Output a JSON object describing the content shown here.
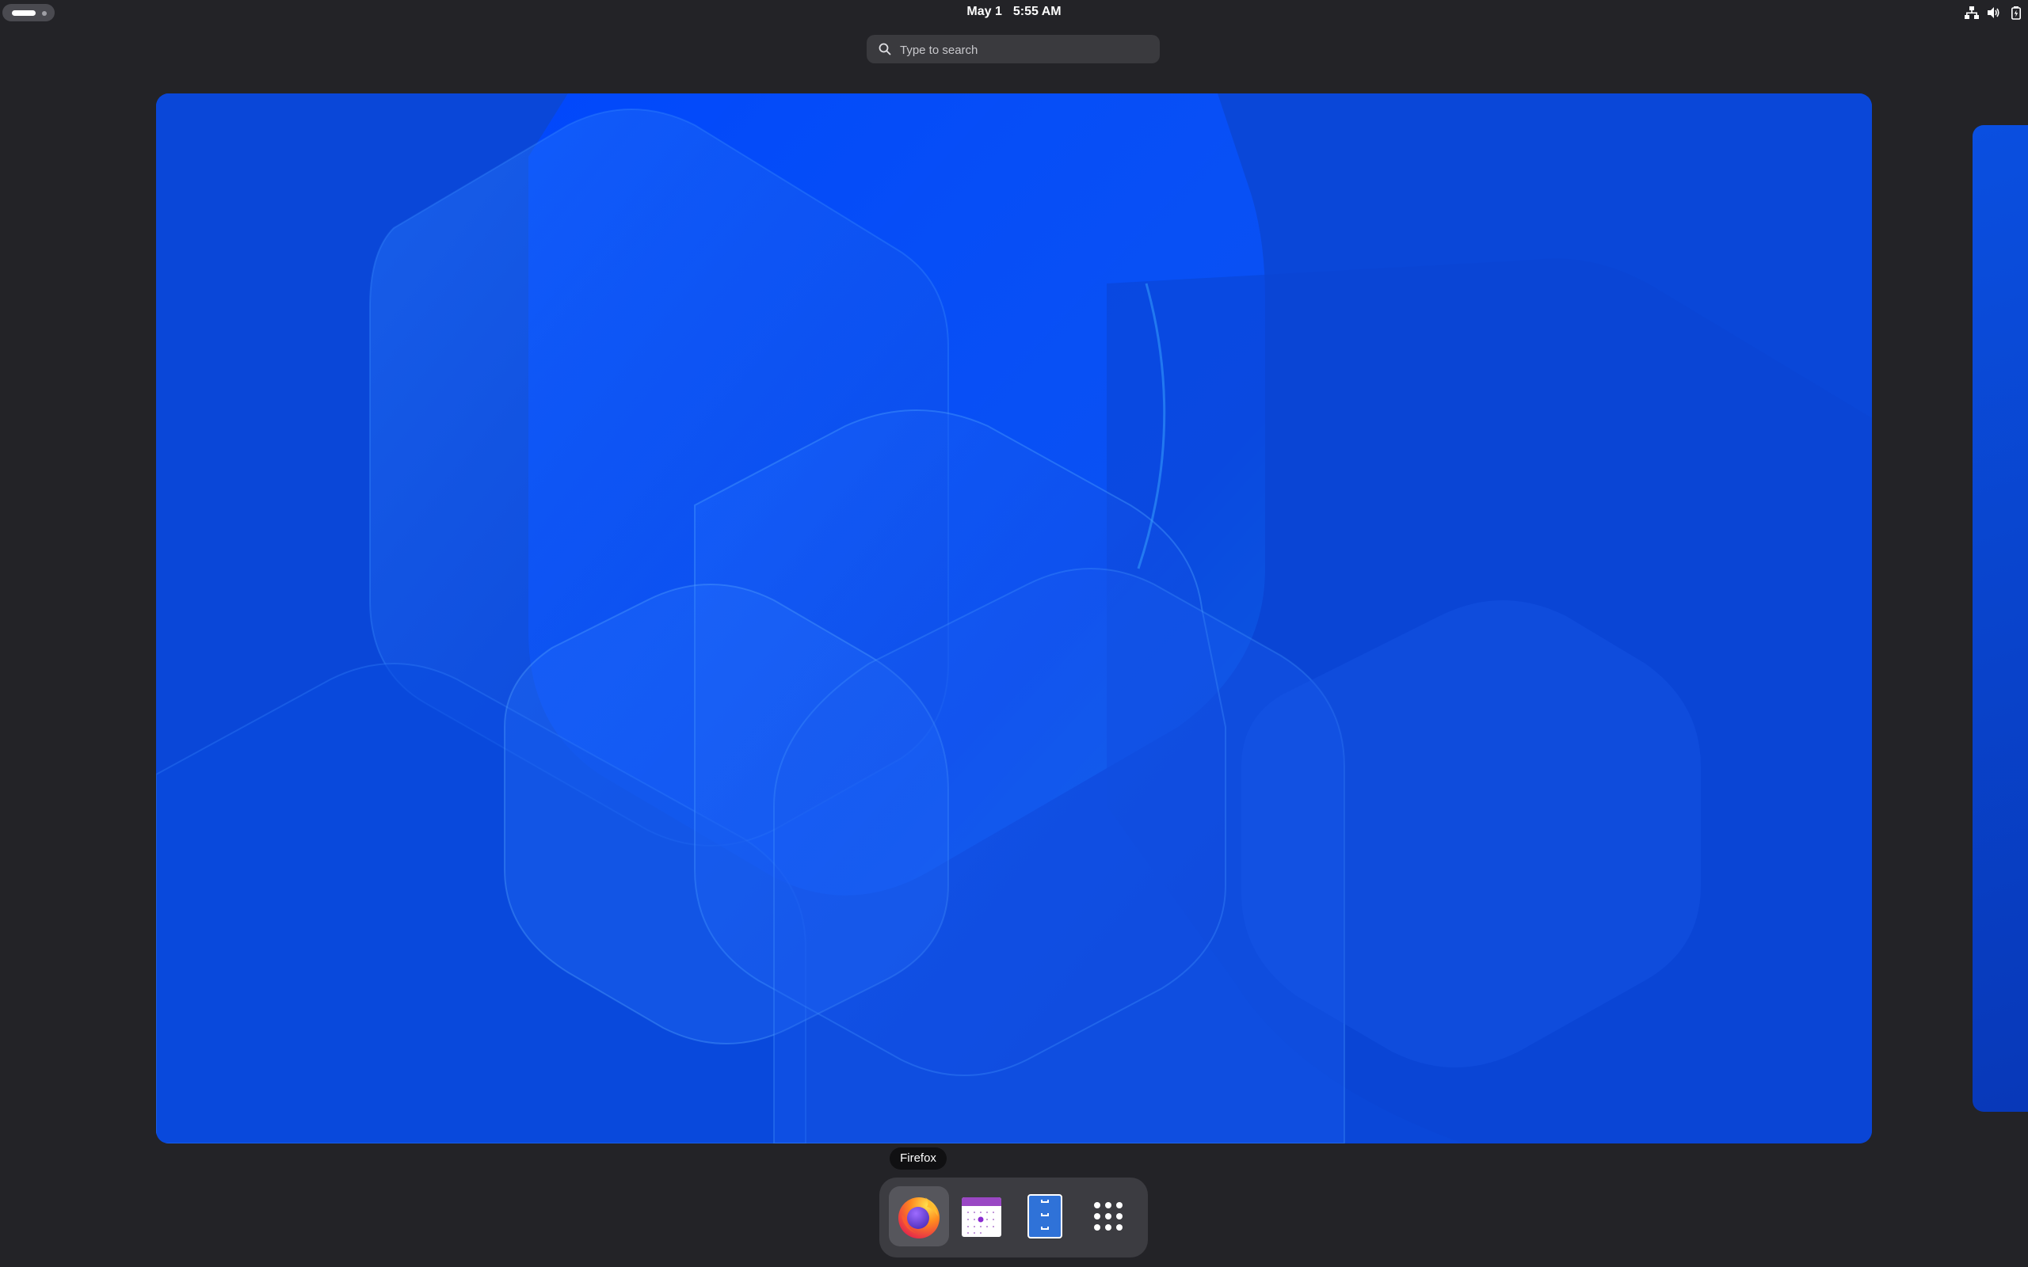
{
  "topbar": {
    "date": "May 1",
    "time": "5:55 AM",
    "tray_icons": [
      "network-icon",
      "volume-icon",
      "battery-icon"
    ]
  },
  "search": {
    "placeholder": "Type to search"
  },
  "dash": {
    "tooltip": "Firefox",
    "apps": [
      {
        "name": "Firefox",
        "icon": "firefox-icon"
      },
      {
        "name": "Calendar",
        "icon": "calendar-icon"
      },
      {
        "name": "Files",
        "icon": "files-icon"
      },
      {
        "name": "Show Apps",
        "icon": "app-grid-icon"
      }
    ]
  },
  "colors": {
    "panel_bg": "#232327",
    "wallpaper_blue": "#0a4fe0",
    "dash_bg": "#3c3c41"
  }
}
